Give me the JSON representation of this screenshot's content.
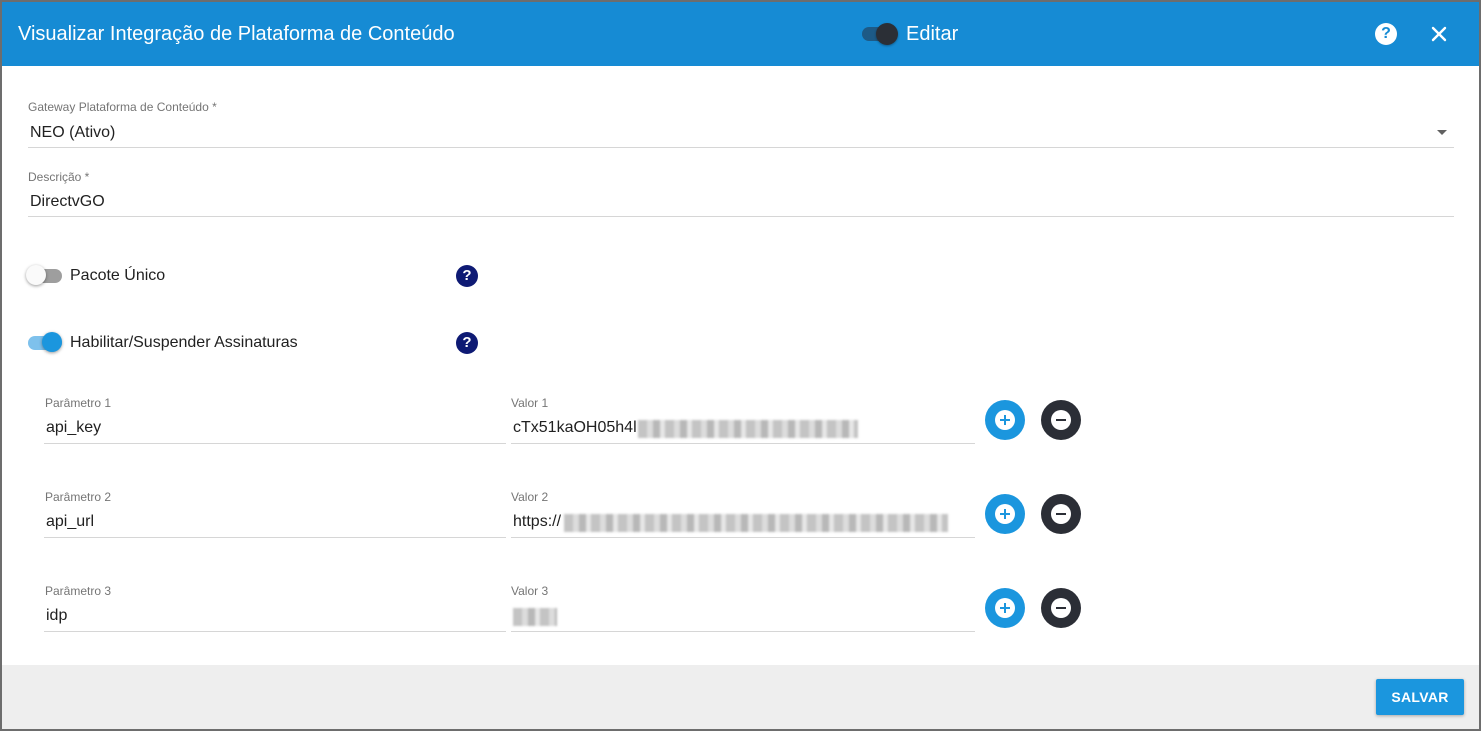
{
  "header": {
    "title": "Visualizar Integração de Plataforma de Conteúdo",
    "edit_label": "Editar",
    "help_icon": "?",
    "close_icon": "✕"
  },
  "form": {
    "gateway": {
      "label": "Gateway Plataforma de Conteúdo *",
      "value": "NEO (Ativo)"
    },
    "descricao": {
      "label": "Descrição *",
      "value": "DirectvGO"
    },
    "pacote_unico": {
      "label": "Pacote Único",
      "enabled": false
    },
    "habilitar": {
      "label": "Habilitar/Suspender Assinaturas",
      "enabled": true
    },
    "help_icon": "?"
  },
  "params": [
    {
      "param_label": "Parâmetro 1",
      "param_value": "api_key",
      "valor_label": "Valor 1",
      "valor_value": "cTx51kaOH05h4l"
    },
    {
      "param_label": "Parâmetro 2",
      "param_value": "api_url",
      "valor_label": "Valor 2",
      "valor_value": "https://"
    },
    {
      "param_label": "Parâmetro 3",
      "param_value": "idp",
      "valor_label": "Valor 3",
      "valor_value": ""
    }
  ],
  "footer": {
    "save_label": "SALVAR"
  },
  "colors": {
    "header": "#168bd4",
    "accent": "#1b96de",
    "dark": "#2b2e36",
    "help": "#0e1a74"
  }
}
